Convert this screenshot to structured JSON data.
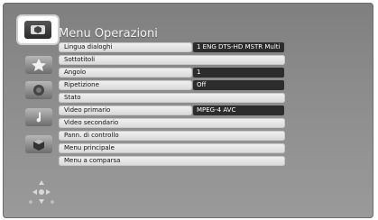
{
  "menu": {
    "title": "Menu Operazioni",
    "items": [
      {
        "label": "Lingua dialoghi",
        "value": "1 ENG DTS-HD MSTR Multi"
      },
      {
        "label": "Sottotitoli"
      },
      {
        "label": "Angolo",
        "value": "1"
      },
      {
        "label": "Ripetizione",
        "value": "Off"
      },
      {
        "label": "Stato"
      },
      {
        "label": "Video primario",
        "value": "MPEG-4 AVC"
      },
      {
        "label": "Video secondario"
      },
      {
        "label": "Pann. di controllo"
      },
      {
        "label": "Menu principale"
      },
      {
        "label": "Menu a comparsa"
      }
    ]
  },
  "left_icons": [
    "disc-icon",
    "star-icon",
    "speaker-icon",
    "music-note-icon",
    "box-icon"
  ],
  "colors": {
    "background": "#8c8c8c",
    "row": "#e6e6e6",
    "value_bg": "#2c2c2c",
    "title": "#f4f4f4"
  }
}
